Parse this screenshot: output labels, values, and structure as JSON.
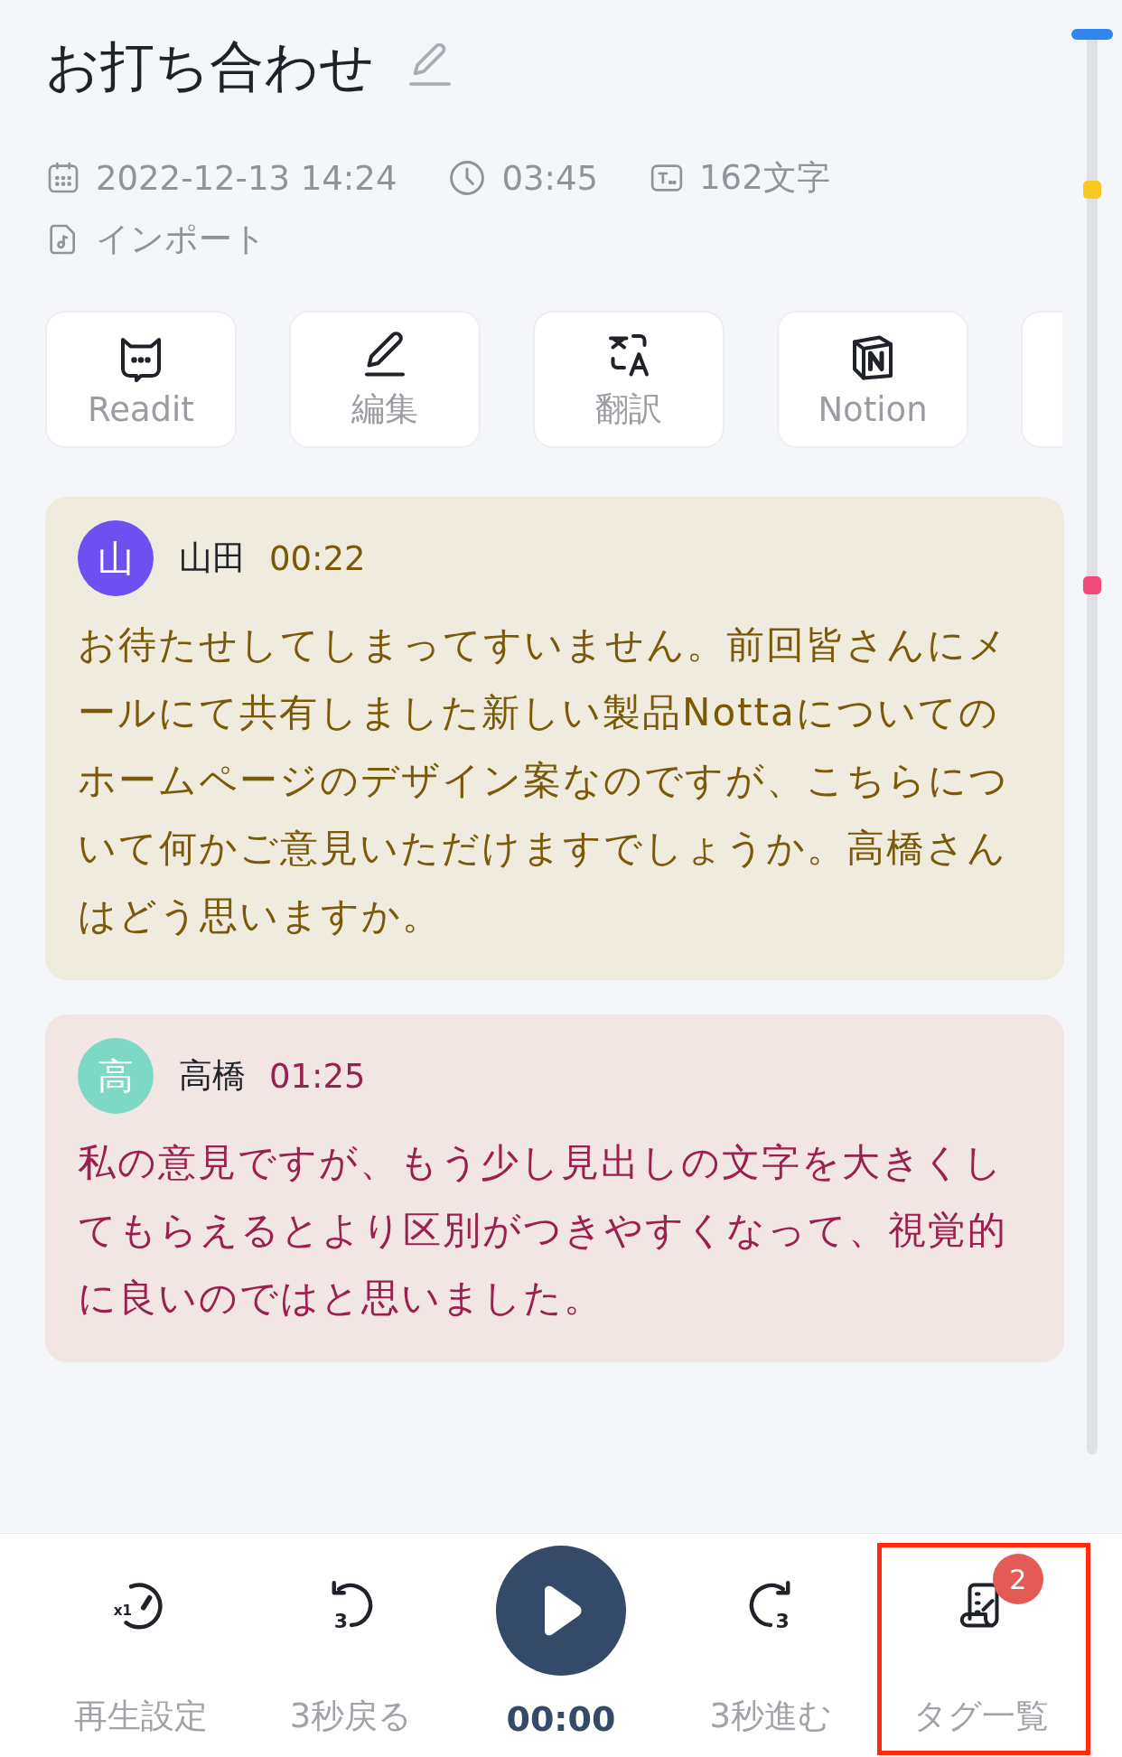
{
  "title": "お打ち合わせ",
  "meta": [
    {
      "kind": "date",
      "text": "2022-12-13 14:24"
    },
    {
      "kind": "duration",
      "text": "03:45"
    },
    {
      "kind": "chars",
      "text": "162文字"
    },
    {
      "kind": "source",
      "text": "インポート"
    }
  ],
  "actions": [
    {
      "kind": "readit",
      "label": "Readit"
    },
    {
      "kind": "edit",
      "label": "編集"
    },
    {
      "kind": "translate",
      "label": "翻訳"
    },
    {
      "kind": "notion",
      "label": "Notion"
    },
    {
      "kind": "partial"
    }
  ],
  "utterances": [
    {
      "avatar": {
        "text": "山",
        "color": "#6e4ff0"
      },
      "speaker": "山田",
      "time": "00:22",
      "color": "#7a5a08",
      "text": "お待たせしてしまってすいません。前回皆さんにメールにて共有しました新しい製品Nottaについてのホームページのデザイン案なのですが、こちらについて何かご意見いただけますでしょうか。高橋さんはどう思いますか。"
    },
    {
      "avatar": {
        "text": "高",
        "color": "#7dd8c5"
      },
      "speaker": "高橋",
      "time": "01:25",
      "color": "#9b1f50",
      "text": "私の意見ですが、もう少し見出しの文字を大きくしてもらえるとより区別がつきやすくなって、視覚的に良いのではと思いました。"
    }
  ],
  "timeline": {
    "markers": [
      {
        "color": "#f9c922"
      },
      {
        "color": "#f04a7b"
      }
    ]
  },
  "controls": [
    {
      "kind": "speed",
      "icon_text": "x1",
      "label": "再生設定",
      "highlighted": false
    },
    {
      "kind": "back",
      "icon_text": "3",
      "label": "3秒戻る",
      "highlighted": false
    },
    {
      "kind": "play",
      "label": "00:00",
      "highlighted": false
    },
    {
      "kind": "forward",
      "icon_text": "3",
      "label": "3秒進む",
      "highlighted": false
    },
    {
      "kind": "tags",
      "label": "タグ一覧",
      "badge": "2",
      "highlighted": true
    }
  ]
}
